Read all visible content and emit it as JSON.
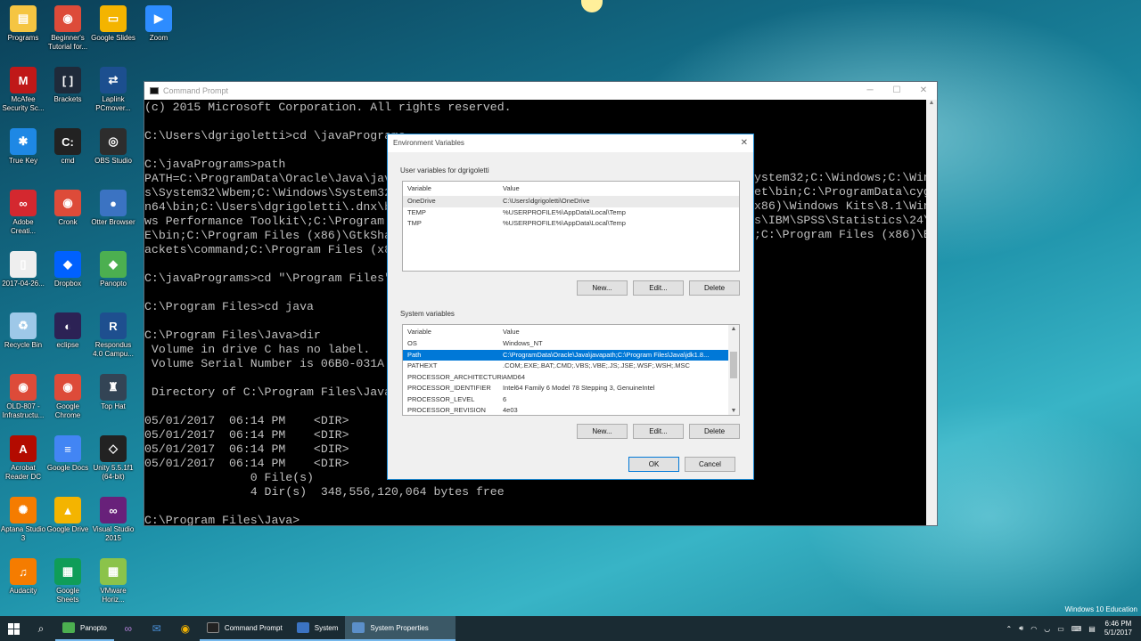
{
  "desktop": {
    "icons": [
      {
        "label": "Programs",
        "color": "#f5c542",
        "glyph": "▤"
      },
      {
        "label": "Beginner's Tutorial for...",
        "color": "#dd4b39",
        "glyph": "◉"
      },
      {
        "label": "Google Slides",
        "color": "#f4b400",
        "glyph": "▭"
      },
      {
        "label": "Zoom",
        "color": "#2d8cff",
        "glyph": "▶"
      },
      {
        "label": "McAfee Security Sc...",
        "color": "#c01818",
        "glyph": "M"
      },
      {
        "label": "Brackets",
        "color": "#1f2a3a",
        "glyph": "[ ]"
      },
      {
        "label": "Laplink PCmover...",
        "color": "#1c4f8f",
        "glyph": "⇄"
      },
      {
        "label": "True Key",
        "color": "#1e88e5",
        "glyph": "✱"
      },
      {
        "label": "cmd",
        "color": "#222222",
        "glyph": "C:"
      },
      {
        "label": "OBS Studio",
        "color": "#2d2d2d",
        "glyph": "◎"
      },
      {
        "label": "Adobe Creati...",
        "color": "#d4282f",
        "glyph": "∞"
      },
      {
        "label": "Cronk",
        "color": "#dd4b39",
        "glyph": "◉"
      },
      {
        "label": "Otter Browser",
        "color": "#3b73c2",
        "glyph": "●"
      },
      {
        "label": "2017-04-26...",
        "color": "#eeeeee",
        "glyph": "▯"
      },
      {
        "label": "Dropbox",
        "color": "#0061fe",
        "glyph": "◆"
      },
      {
        "label": "Panopto",
        "color": "#4caf50",
        "glyph": "◆"
      },
      {
        "label": "Recycle Bin",
        "color": "#9ec8e8",
        "glyph": "♻"
      },
      {
        "label": "eclipse",
        "color": "#2c2255",
        "glyph": "◐"
      },
      {
        "label": "Respondus 4.0 Campu...",
        "color": "#1e4f8f",
        "glyph": "R"
      },
      {
        "label": "OLD-807 - Infrastructu...",
        "color": "#dd4b39",
        "glyph": "◉"
      },
      {
        "label": "Google Chrome",
        "color": "#dd4b39",
        "glyph": "◉"
      },
      {
        "label": "Top Hat",
        "color": "#334455",
        "glyph": "♜"
      },
      {
        "label": "Acrobat Reader DC",
        "color": "#b30b00",
        "glyph": "A"
      },
      {
        "label": "Google Docs",
        "color": "#4285f4",
        "glyph": "≡"
      },
      {
        "label": "Unity 5.5.1f1 (64-bit)",
        "color": "#222222",
        "glyph": "◇"
      },
      {
        "label": "Aptana Studio 3",
        "color": "#f57c00",
        "glyph": "✺"
      },
      {
        "label": "Google Drive",
        "color": "#f4b400",
        "glyph": "▲"
      },
      {
        "label": "Visual Studio 2015",
        "color": "#68217a",
        "glyph": "∞"
      },
      {
        "label": "Audacity",
        "color": "#f57c00",
        "glyph": "♫"
      },
      {
        "label": "Google Sheets",
        "color": "#0f9d58",
        "glyph": "▦"
      },
      {
        "label": "VMware Horiz...",
        "color": "#8bc34a",
        "glyph": "▦"
      }
    ]
  },
  "cmd": {
    "title": "Command Prompt",
    "lines": "(c) 2015 Microsoft Corporation. All rights reserved.\n\nC:\\Users\\dgrigoletti>cd \\javaPrograms\n\nC:\\javaPrograms>path\nPATH=C:\\ProgramData\\Oracle\\Java\\javap\ns\\System32\\Wbem;C:\\Windows\\System32\\W\nn64\\bin;C:\\Users\\dgrigoletti\\.dnx\\bin\nws Performance Toolkit\\;C:\\Program Fil\nE\\bin;C:\\Program Files (x86)\\GtkSharp\nackets\\command;C:\\Program Files (x86)\n\nC:\\javaPrograms>cd \"\\Program Files\"\n\nC:\\Program Files>cd java\n\nC:\\Program Files\\Java>dir\n Volume in drive C has no label.\n Volume Serial Number is 06B0-031A\n\n Directory of C:\\Program Files\\Java\n\n05/01/2017  06:14 PM    <DIR>\n05/01/2017  06:14 PM    <DIR>\n05/01/2017  06:14 PM    <DIR>\n05/01/2017  06:14 PM    <DIR>\n               0 File(s)\n               4 Dir(s)  348,556,120,064 bytes free\n\nC:\\Program Files\\Java>",
    "right_lines": "\n\n\n\n\nystem32;C:\\Windows;C:\\Window\net\\bin;C:\\ProgramData\\cygwi\nx86)\\Windows Kits\\8.1\\Windo\ns\\IBM\\SPSS\\Statistics\\24\\JR\n;C:\\Program Files (x86)\\Br"
  },
  "dialog": {
    "title": "Environment Variables",
    "user_section_label": "User variables for dgrigoletti",
    "user_header": {
      "variable": "Variable",
      "value": "Value"
    },
    "user_vars": [
      {
        "name": "OneDrive",
        "value": "C:\\Users\\dgrigoletti\\OneDrive"
      },
      {
        "name": "TEMP",
        "value": "%USERPROFILE%\\AppData\\Local\\Temp"
      },
      {
        "name": "TMP",
        "value": "%USERPROFILE%\\AppData\\Local\\Temp"
      }
    ],
    "system_section_label": "System variables",
    "system_header": {
      "variable": "Variable",
      "value": "Value"
    },
    "system_vars": [
      {
        "name": "OS",
        "value": "Windows_NT"
      },
      {
        "name": "Path",
        "value": "C:\\ProgramData\\Oracle\\Java\\javapath;C:\\Program Files\\Java\\jdk1.8..."
      },
      {
        "name": "PATHEXT",
        "value": ".COM;.EXE;.BAT;.CMD;.VBS;.VBE;.JS;.JSE;.WSF;.WSH;.MSC"
      },
      {
        "name": "PROCESSOR_ARCHITECTURE",
        "value": "AMD64"
      },
      {
        "name": "PROCESSOR_IDENTIFIER",
        "value": "Intel64 Family 6 Model 78 Stepping 3, GenuineIntel"
      },
      {
        "name": "PROCESSOR_LEVEL",
        "value": "6"
      },
      {
        "name": "PROCESSOR_REVISION",
        "value": "4e03"
      }
    ],
    "buttons": {
      "new": "New...",
      "edit": "Edit...",
      "delete": "Delete",
      "ok": "OK",
      "cancel": "Cancel"
    }
  },
  "taskbar": {
    "apps": [
      {
        "label": "Panopto",
        "color": "#4caf50"
      },
      {
        "label": "Command Prompt",
        "color": "#222222"
      },
      {
        "label": "System",
        "color": "#3b73c2"
      },
      {
        "label": "System Properties",
        "color": "#5b8fc9"
      }
    ],
    "time": "6:46 PM",
    "date": "5/1/2017",
    "edition": "Windows 10 Education"
  }
}
